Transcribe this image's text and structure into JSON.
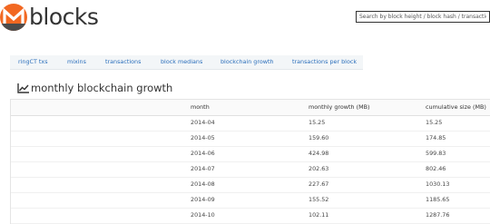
{
  "header": {
    "logo_text": "blocks",
    "search_placeholder": "Search by block height / block hash / transaction hash"
  },
  "nav": {
    "items": [
      {
        "label": "ringCT txs"
      },
      {
        "label": "mixins"
      },
      {
        "label": "transactions"
      },
      {
        "label": "block medians"
      },
      {
        "label": "blockchain growth"
      },
      {
        "label": "transactions per block"
      }
    ]
  },
  "page": {
    "title": "monthly blockchain growth"
  },
  "table": {
    "columns": [
      "month",
      "monthly growth (MB)",
      "cumulative size (MB)"
    ],
    "rows": [
      {
        "month": "2014-04",
        "growth": "15.25",
        "cumulative": "15.25"
      },
      {
        "month": "2014-05",
        "growth": "159.60",
        "cumulative": "174.85"
      },
      {
        "month": "2014-06",
        "growth": "424.98",
        "cumulative": "599.83"
      },
      {
        "month": "2014-07",
        "growth": "202.63",
        "cumulative": "802.46"
      },
      {
        "month": "2014-08",
        "growth": "227.67",
        "cumulative": "1030.13"
      },
      {
        "month": "2014-09",
        "growth": "155.52",
        "cumulative": "1185.65"
      },
      {
        "month": "2014-10",
        "growth": "102.11",
        "cumulative": "1287.76"
      }
    ]
  },
  "colors": {
    "brand_orange": "#f26822",
    "brand_dark": "#4c4c4c",
    "link": "#2a6ebb",
    "nav_bg": "#f3f6f8"
  },
  "icons": {
    "logo": "monero-logo-icon",
    "title": "line-chart-icon"
  }
}
